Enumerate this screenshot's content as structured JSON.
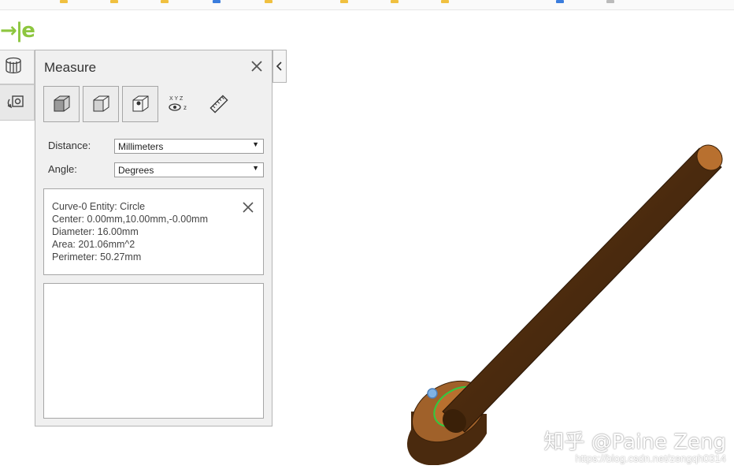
{
  "logo_text": "→|e",
  "panel": {
    "title": "Measure",
    "close_icon": "close-icon",
    "collapse_icon": "chevron-left-icon",
    "tools": [
      "cube-solid-icon",
      "cube-wire-icon",
      "cube-vertex-icon",
      "show-xyz-icon",
      "ruler-icon"
    ],
    "tool_xyz_label": "X Y Z",
    "distance_label": "Distance:",
    "distance_value": "Millimeters",
    "angle_label": "Angle:",
    "angle_value": "Degrees",
    "result": {
      "line1": "Curve-0 Entity: Circle",
      "line2": "Center: 0.00mm,10.00mm,-0.00mm",
      "line3": "Diameter: 16.00mm",
      "line4": "Area: 201.06mm^2",
      "line5": "Perimeter: 50.27mm"
    }
  },
  "sidebar": [
    "tree-icon",
    "camera-views-icon"
  ],
  "watermark": {
    "name": "知乎 @Paine Zeng",
    "url": "https://blog.csdn.net/zengqh0314"
  },
  "colors": {
    "accent": "#8dc63f",
    "rod": "#5a3415",
    "rod_top": "#b8702f",
    "highlight": "#2ecc40",
    "point": "#7fb2e5"
  }
}
